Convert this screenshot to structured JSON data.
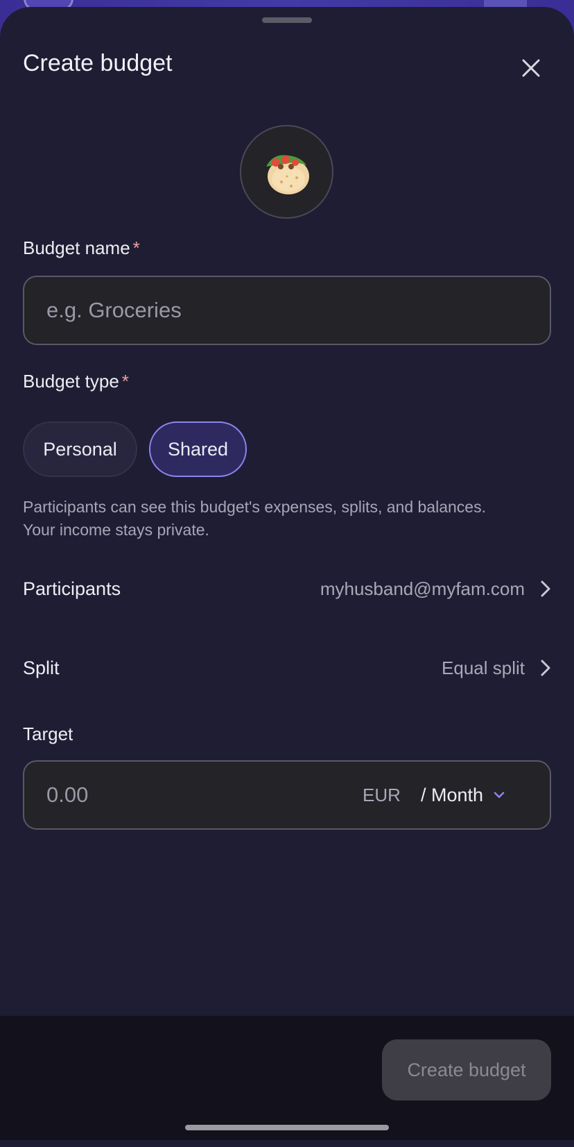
{
  "sheet": {
    "title": "Create budget",
    "close_icon": "close-icon",
    "emoji_icon": "burrito-emoji-icon"
  },
  "budget_name": {
    "label": "Budget name",
    "required_mark": "*",
    "value": "",
    "placeholder": "e.g. Groceries"
  },
  "budget_type": {
    "label": "Budget type",
    "required_mark": "*",
    "options": [
      {
        "label": "Personal",
        "selected": false
      },
      {
        "label": "Shared",
        "selected": true
      }
    ],
    "helper_line1": "Participants can see this budget's expenses, splits, and balances.",
    "helper_line2": "Your income stays private."
  },
  "participants": {
    "label": "Participants",
    "value": "myhusband@myfam.com",
    "icon": "chevron-right-icon"
  },
  "split": {
    "label": "Split",
    "value": "Equal split",
    "icon": "chevron-right-icon"
  },
  "target": {
    "label": "Target",
    "value": "",
    "placeholder": "0.00",
    "currency": "EUR",
    "period": "/ Month",
    "period_icon": "chevron-down-icon"
  },
  "footer": {
    "create_label": "Create budget",
    "create_enabled": false
  },
  "colors": {
    "sheet_bg": "#1f1d33",
    "accent": "#8d86f0",
    "required": "#f2a19c"
  }
}
